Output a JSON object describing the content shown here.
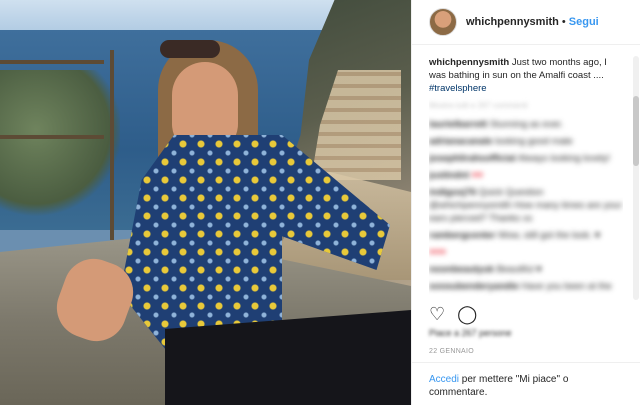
{
  "post": {
    "username": "whichpennysmith",
    "separator": "•",
    "follow_label": "Segui",
    "caption_text": "Just two months ago, I was bathing in sun on the Amalfi coast ....",
    "hashtag": "#travelsphere",
    "caption_meta": "Mostra tutti e 267 commenti",
    "comments": [
      {
        "user": "laurielbarrett",
        "text": "Stunning as ever."
      },
      {
        "user": "adrianacanale",
        "text": "looking good mate"
      },
      {
        "user": "josephlirahsofficial",
        "text": "Always looking lovely!"
      },
      {
        "user": "justindnt",
        "text": "♥♥"
      },
      {
        "user": "indigoxj76",
        "text": "Quick Question @whichpennysmith How many times are your ears pierced? Thanks xx"
      },
      {
        "user": "rambergcenter",
        "text": "Wow, still got the look. ♥"
      },
      {
        "user": "",
        "text": "♥♥♥"
      },
      {
        "user": "noonbeautyuk",
        "text": "Beautiful ♥"
      },
      {
        "user": "soosubenderyandie",
        "text": "Have you been at the"
      }
    ],
    "likes_text": "Piace a 267 persone",
    "date": "22 GENNAIO",
    "footer_login": "Accedi",
    "footer_rest": "per mettere \"Mi piace\" o commentare."
  },
  "icons": {
    "heart": "♡",
    "comment": "◯"
  },
  "colors": {
    "link_blue": "#3897f0",
    "hashtag": "#003569",
    "heart_red": "#ed4956"
  }
}
